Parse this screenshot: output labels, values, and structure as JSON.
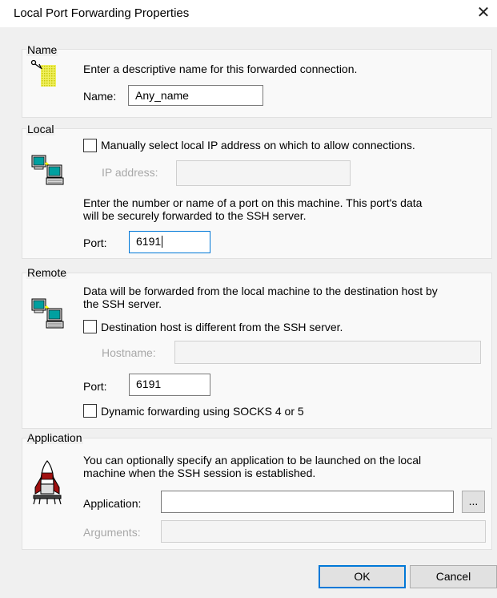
{
  "window": {
    "title": "Local Port Forwarding Properties",
    "close_glyph": "✕"
  },
  "name_section": {
    "legend": "Name",
    "description": "Enter a descriptive name for this forwarded connection.",
    "name_label": "Name:",
    "name_value": "Any_name",
    "icon": "tag-icon"
  },
  "local_section": {
    "legend": "Local",
    "manual_ip_label": "Manually select local IP address on which to allow connections.",
    "manual_ip_checked": false,
    "ip_label": "IP address:",
    "ip_value": "",
    "description_line1": "Enter the number or name of a port on this machine.  This port's data",
    "description_line2": "will be securely forwarded to the SSH server.",
    "port_label": "Port:",
    "port_value": "6191",
    "icon": "computer-icon"
  },
  "remote_section": {
    "legend": "Remote",
    "description_line1": "Data will be forwarded from the local machine to the destination host by",
    "description_line2": "the SSH server.",
    "dest_different_label": "Destination host is different from the SSH server.",
    "dest_different_checked": false,
    "hostname_label": "Hostname:",
    "hostname_value": "",
    "port_label": "Port:",
    "port_value": "6191",
    "dynamic_label": "Dynamic forwarding using SOCKS 4 or 5",
    "dynamic_checked": false,
    "icon": "computer-icon"
  },
  "application_section": {
    "legend": "Application",
    "description_line1": "You can optionally specify an application to be launched on the local",
    "description_line2": "machine when the SSH session is established.",
    "application_label": "Application:",
    "application_value": "",
    "browse_label": "...",
    "arguments_label": "Arguments:",
    "arguments_value": "",
    "icon": "rocket-icon"
  },
  "buttons": {
    "ok": "OK",
    "cancel": "Cancel"
  },
  "colors": {
    "accent": "#0078d7",
    "dialog_bg": "#f0f0f0",
    "section_bg": "#f9f9f9",
    "disabled_text": "#a8a8a8"
  }
}
